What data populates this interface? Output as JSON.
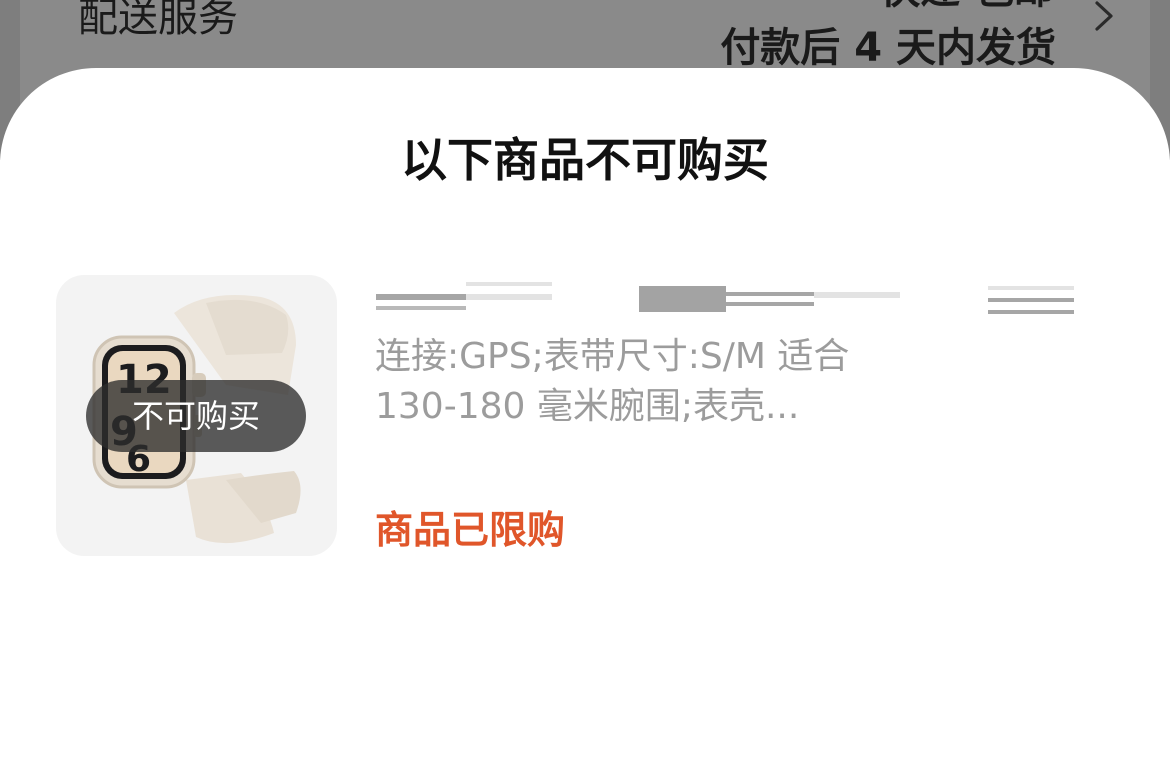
{
  "background": {
    "left_title": "配送服务",
    "right_top": "快递 包邮",
    "right_sub": "付款后 4 天内发货"
  },
  "sheet": {
    "title": "以下商品不可购买",
    "product": {
      "image_icon": "watch-image",
      "badge": "不可购买",
      "spec_line1": "连接:GPS;表带尺寸:S/M 适合",
      "spec_line2": "130-180 毫米腕围;表壳...",
      "status": "商品已限购"
    }
  },
  "colors": {
    "status": "#e0562a",
    "spec_text": "#9c9c9c",
    "dim_overlay": "#7e7e7e"
  }
}
